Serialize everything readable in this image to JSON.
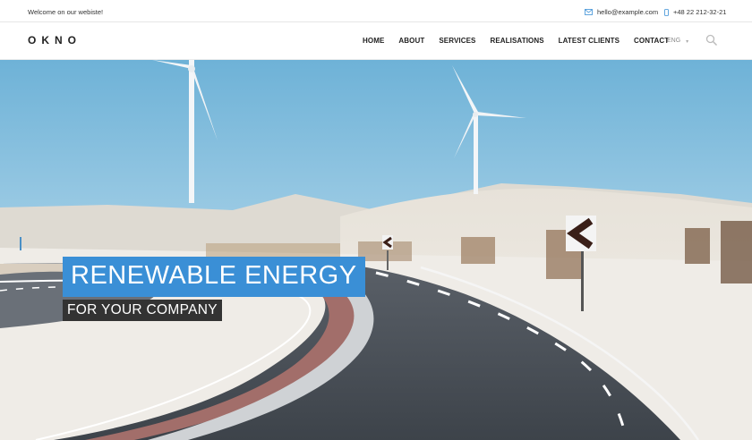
{
  "topbar": {
    "welcome": "Welcome on our webiste!",
    "email": "hello@example.com",
    "phone": "+48 22 212-32-21",
    "email_icon": "envelope-icon",
    "phone_icon": "mobile-phone-icon"
  },
  "nav": {
    "logo": "OKNO",
    "items": [
      {
        "label": "HOME"
      },
      {
        "label": "ABOUT"
      },
      {
        "label": "SERVICES"
      },
      {
        "label": "REALISATIONS"
      },
      {
        "label": "LATEST CLIENTS"
      },
      {
        "label": "CONTACT"
      }
    ],
    "language": "ENG",
    "search_icon": "search-icon"
  },
  "hero": {
    "title": "RENEWABLE ENERGY",
    "subtitle": "FOR YOUR COMPANY"
  },
  "colors": {
    "accent": "#3a8fd6",
    "subtitle_bg": "#333333",
    "text": "#222222"
  }
}
